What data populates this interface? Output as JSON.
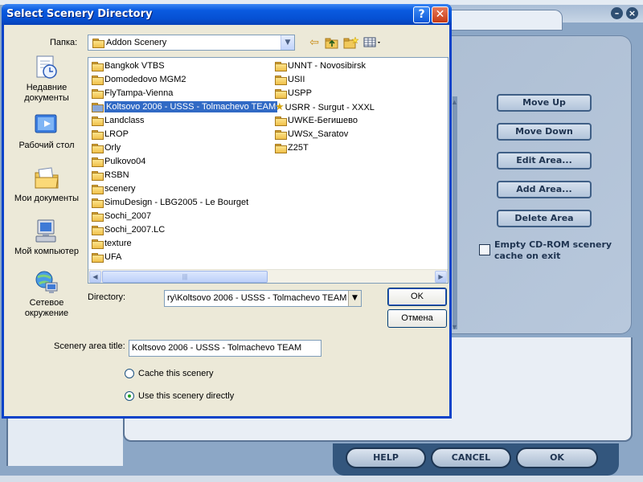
{
  "background_app": {
    "buttons": {
      "move_up": "Move Up",
      "move_down": "Move Down",
      "edit_area": "Edit Area...",
      "add_area": "Add Area...",
      "delete_area": "Delete Area"
    },
    "empty_cache_label": "Empty CD-ROM scenery cache on exit",
    "bottom_buttons": {
      "help": "HELP",
      "cancel": "CANCEL",
      "ok": "OK"
    },
    "window_buttons": {
      "minimize": "–",
      "close": "×"
    }
  },
  "dialog": {
    "title": "Select Scenery Directory",
    "help_glyph": "?",
    "close_glyph": "✕",
    "look_in_label": "Папка:",
    "look_in_value": "Addon Scenery",
    "places": [
      {
        "label": "Недавние документы",
        "icon": "recent-documents-icon"
      },
      {
        "label": "Рабочий стол",
        "icon": "desktop-icon"
      },
      {
        "label": "Мои документы",
        "icon": "my-documents-icon"
      },
      {
        "label": "Мой компьютер",
        "icon": "my-computer-icon"
      },
      {
        "label": "Сетевое окружение",
        "icon": "network-places-icon"
      }
    ],
    "folders_col1": [
      "Bangkok VTBS",
      "Domodedovo MGM2",
      "FlyTampa-Vienna",
      "Koltsovo 2006 - USSS - Tolmachevo TEAM",
      "Landclass",
      "LROP",
      "Orly",
      "Pulkovo04",
      "RSBN",
      "scenery",
      "SimuDesign - LBG2005 - Le Bourget",
      "Sochi_2007",
      "Sochi_2007.LC",
      "texture",
      "UFA"
    ],
    "folders_col2": [
      "UNNT - Novosibirsk",
      "USII",
      "USPP",
      "USRR - Surgut - XXXL",
      "UWKE-Бегишево",
      "UWSx_Saratov",
      "Z25T"
    ],
    "selected_folder": "Koltsovo 2006 - USSS - Tolmachevo TEAM",
    "directory_label": "Directory:",
    "directory_value": "ry\\Koltsovo 2006 - USSS - Tolmachevo TEAM",
    "ok_label": "OK",
    "cancel_label": "Отмена",
    "area_title_label": "Scenery area title:",
    "area_title_value": "Koltsovo 2006 - USSS - Tolmachevo TEAM",
    "radio_cache": "Cache this scenery",
    "radio_direct": "Use this scenery directly",
    "radio_selected": "direct"
  },
  "colors": {
    "titlebar": "#0a5be0",
    "selection": "#316ac5",
    "fs_button_text": "#1f3451"
  }
}
